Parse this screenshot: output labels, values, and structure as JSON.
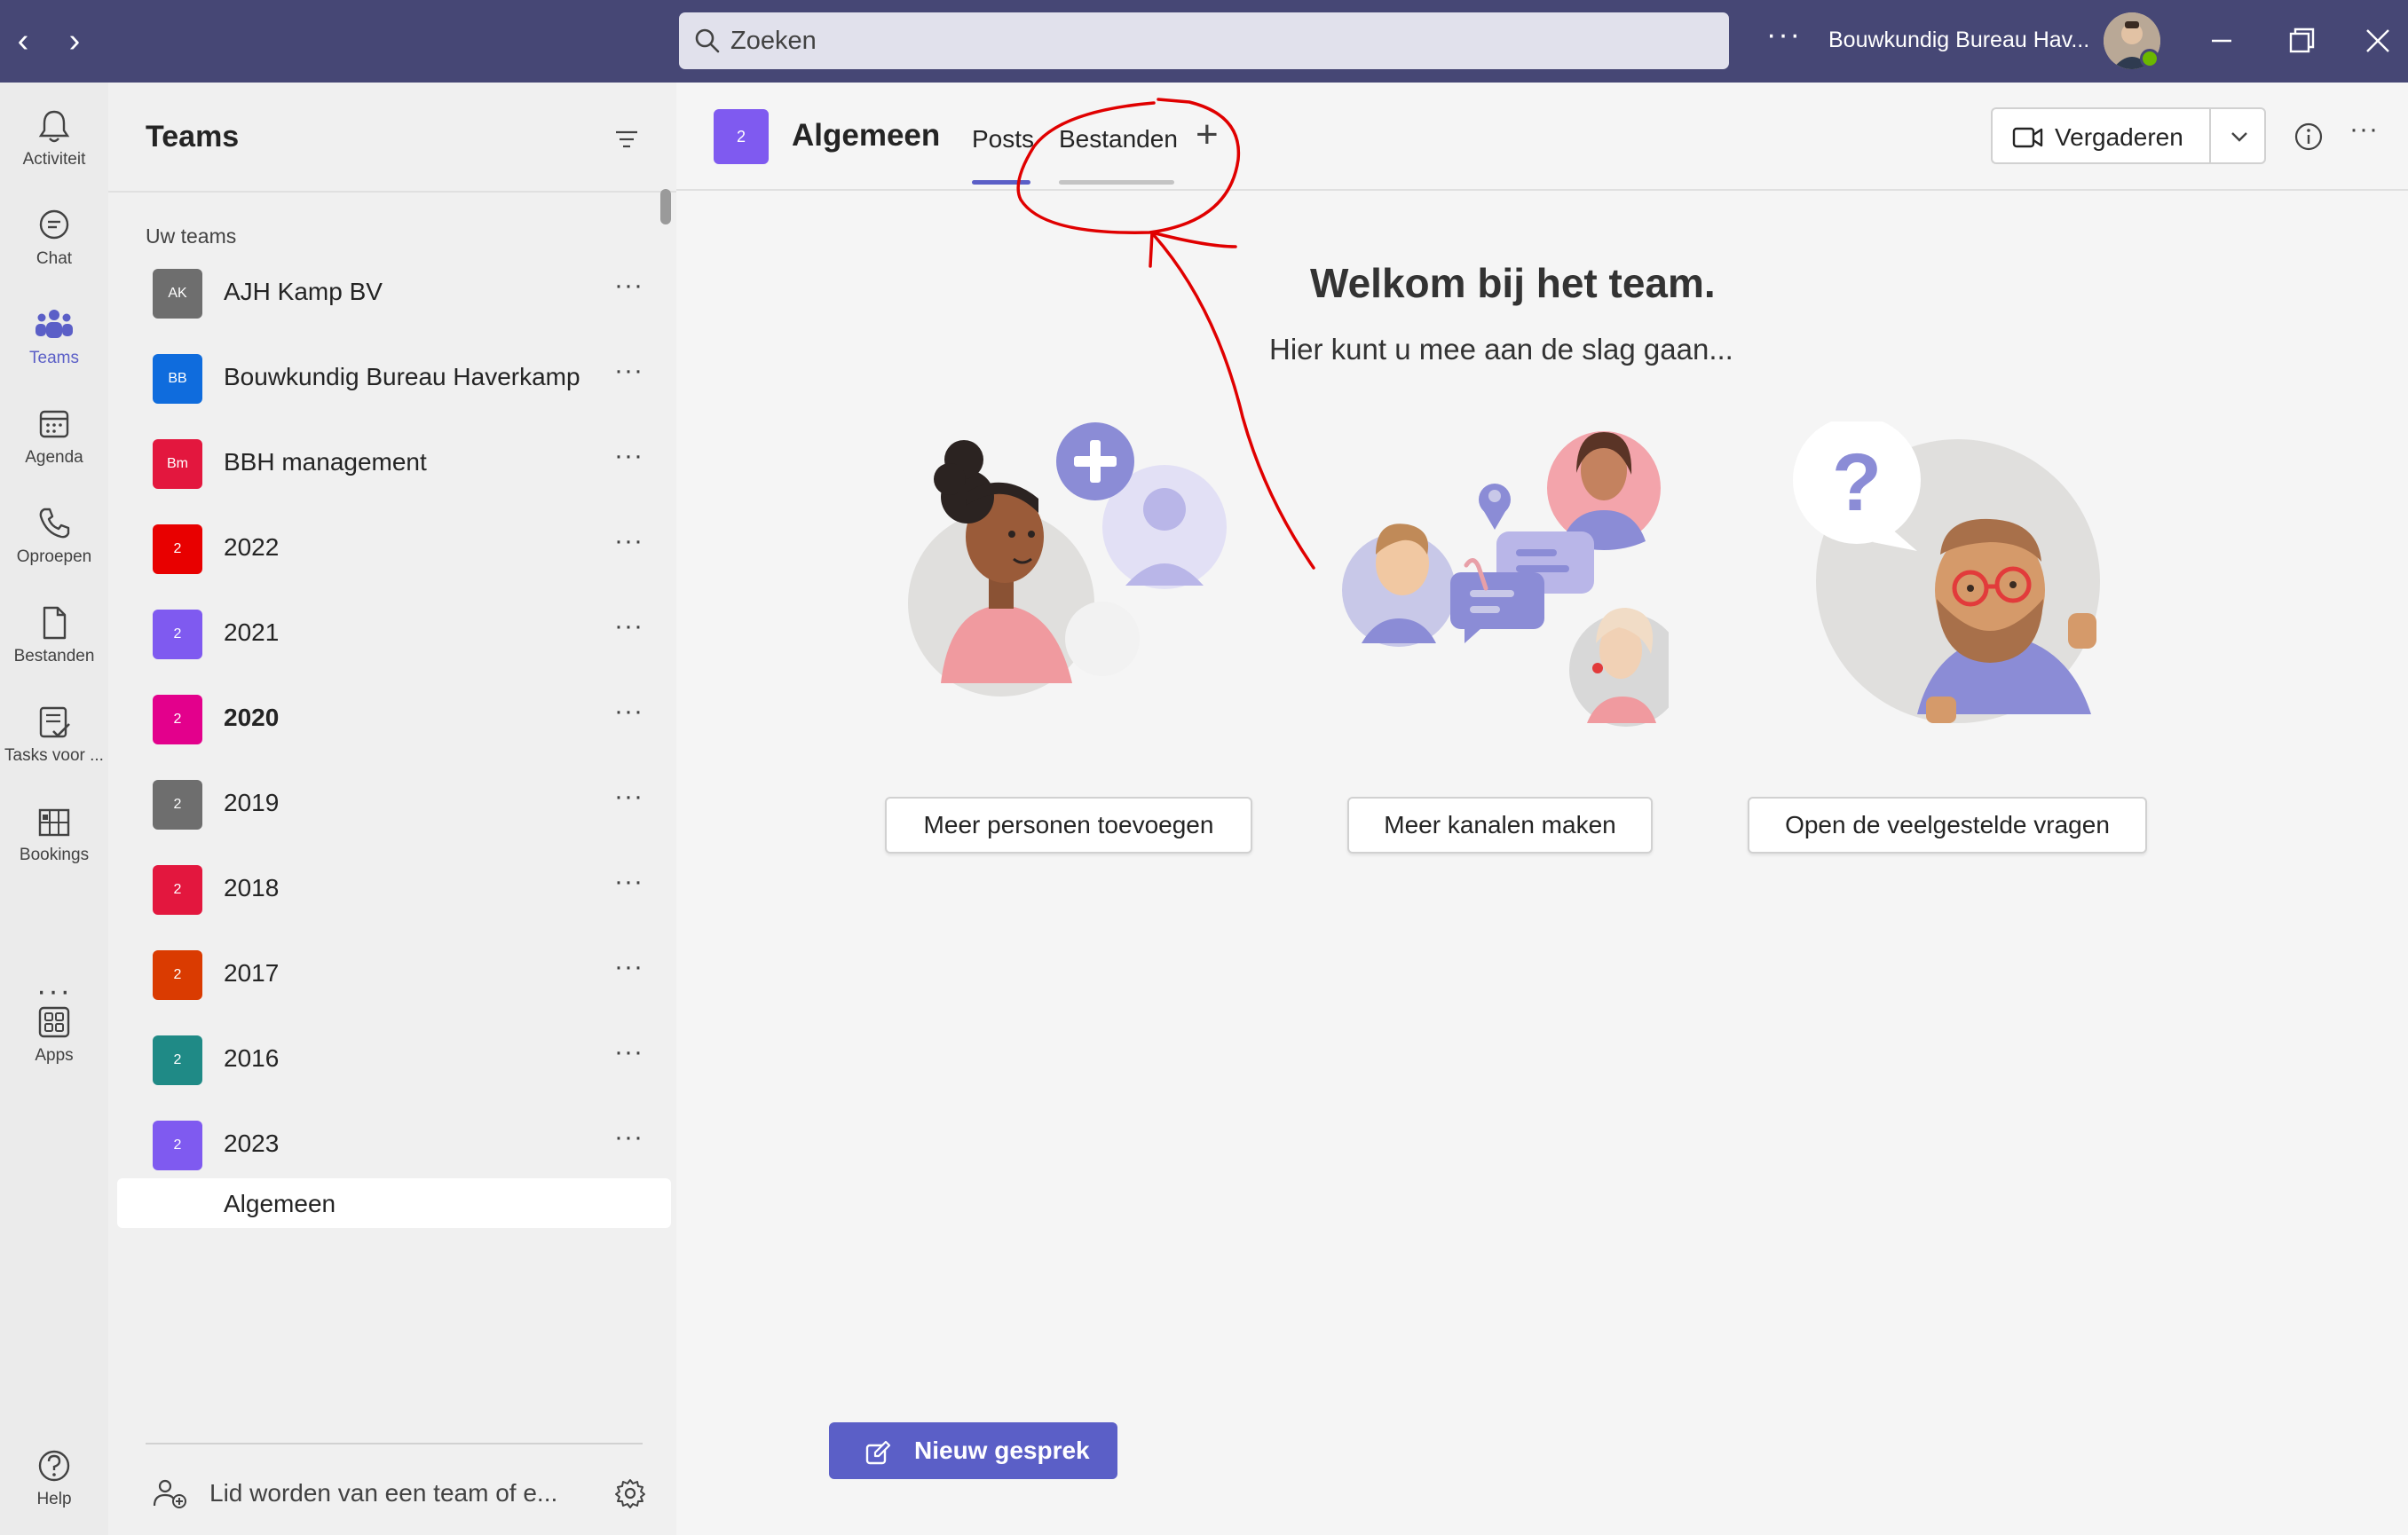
{
  "topbar": {
    "back_icon": "chevron-left-icon",
    "forward_icon": "chevron-right-icon",
    "search_placeholder": "Zoeken",
    "more": "···",
    "tenant": "Bouwkundig Bureau Hav...",
    "presence_color": "#6bb700",
    "brand_color": "#464775"
  },
  "rail": {
    "items": [
      {
        "label": "Activiteit",
        "icon": "bell-icon"
      },
      {
        "label": "Chat",
        "icon": "chat-icon"
      },
      {
        "label": "Teams",
        "icon": "teams-icon",
        "active": true
      },
      {
        "label": "Agenda",
        "icon": "calendar-icon"
      },
      {
        "label": "Oproepen",
        "icon": "phone-icon"
      },
      {
        "label": "Bestanden",
        "icon": "file-icon"
      },
      {
        "label": "Tasks voor ...",
        "icon": "tasks-icon"
      },
      {
        "label": "Bookings",
        "icon": "bookings-icon"
      },
      {
        "label": "Apps",
        "icon": "apps-icon"
      },
      {
        "label": "Help",
        "icon": "help-icon"
      }
    ],
    "more": "···"
  },
  "panel": {
    "title": "Teams",
    "section_label": "Uw teams",
    "teams": [
      {
        "badge": "AK",
        "name": "AJH Kamp BV",
        "color": "#6e6e6e"
      },
      {
        "badge": "BB",
        "name": "Bouwkundig Bureau Haverkamp",
        "color": "#0f6cdd"
      },
      {
        "badge": "Bm",
        "name": "BBH management",
        "color": "#e3173e"
      },
      {
        "badge": "2",
        "name": "2022",
        "color": "#e80000"
      },
      {
        "badge": "2",
        "name": "2021",
        "color": "#7f5af0"
      },
      {
        "badge": "2",
        "name": "2020",
        "color": "#e3008c",
        "bold": true
      },
      {
        "badge": "2",
        "name": "2019",
        "color": "#6e6e6e"
      },
      {
        "badge": "2",
        "name": "2018",
        "color": "#e3173e"
      },
      {
        "badge": "2",
        "name": "2017",
        "color": "#da3b01"
      },
      {
        "badge": "2",
        "name": "2016",
        "color": "#1f8a86"
      },
      {
        "badge": "2",
        "name": "2023",
        "color": "#7f5af0"
      }
    ],
    "row_more": "···",
    "selected_channel": "Algemeen",
    "join_label": "Lid worden van een team of e..."
  },
  "header": {
    "badge": "2",
    "badge_color": "#7f5af0",
    "title": "Algemeen",
    "tabs": [
      {
        "label": "Posts",
        "active": true
      },
      {
        "label": "Bestanden",
        "active": false
      }
    ],
    "add_tab": "+",
    "meet_label": "Vergaderen",
    "more": "···"
  },
  "welcome": {
    "title": "Welkom bij het team.",
    "subtitle": "Hier kunt u mee aan de slag gaan...",
    "actions": [
      {
        "label": "Meer personen toevoegen"
      },
      {
        "label": "Meer kanalen maken"
      },
      {
        "label": "Open de veelgestelde vragen"
      }
    ]
  },
  "compose": {
    "label": "Nieuw gesprek",
    "icon": "compose-icon",
    "accent": "#5b5fc7"
  },
  "annotation": {
    "color": "#e00000"
  }
}
